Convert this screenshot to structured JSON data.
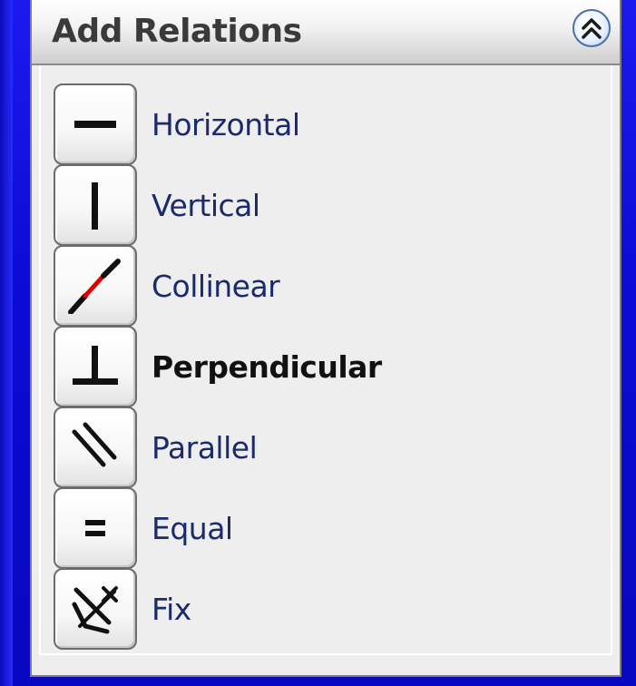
{
  "panel": {
    "title": "Add Relations",
    "collapse_icon": "double-chevron-up-icon"
  },
  "relations": [
    {
      "label": "Horizontal",
      "icon": "horizontal-line-icon",
      "bold": false
    },
    {
      "label": "Vertical",
      "icon": "vertical-line-icon",
      "bold": false
    },
    {
      "label": "Collinear",
      "icon": "collinear-icon",
      "bold": false
    },
    {
      "label": "Perpendicular",
      "icon": "perpendicular-icon",
      "bold": true
    },
    {
      "label": "Parallel",
      "icon": "parallel-icon",
      "bold": false
    },
    {
      "label": "Equal",
      "icon": "equal-icon",
      "bold": false
    },
    {
      "label": "Fix",
      "icon": "fix-anchor-icon",
      "bold": false
    }
  ],
  "colors": {
    "background": "#0a0ad4",
    "panel": "#eeeeee",
    "label_text": "#1a2a6a",
    "collinear_accent": "#e00000"
  }
}
